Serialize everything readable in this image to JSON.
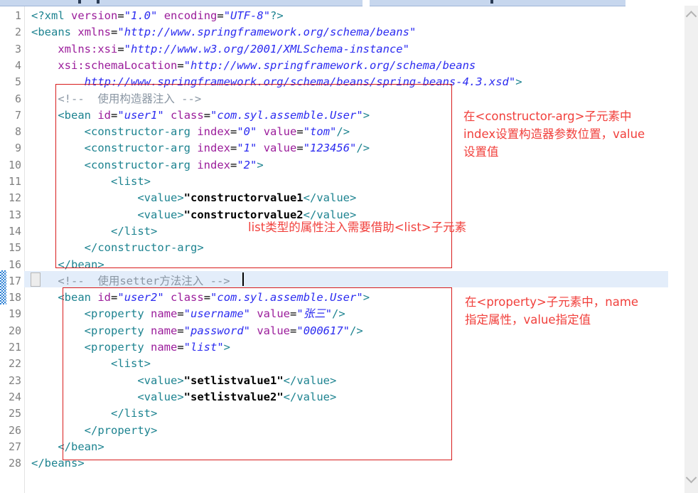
{
  "window": {
    "chrome_strips": [
      {
        "name": "toolbar-strip-left"
      },
      {
        "name": "toolbar-strip-right"
      }
    ]
  },
  "editor": {
    "language": "xml",
    "current_line": 17,
    "total_lines": 28,
    "colors": {
      "tag": "#1d8390",
      "attribute": "#9b1d9b",
      "value": "#2c2cf0",
      "comment": "#8a96a3",
      "text": "#000000",
      "annotation_red": "#f1403c",
      "box_red": "#d81c1c",
      "current_line_bg": "#e3edfa"
    },
    "line_numbers": [
      "1",
      "2",
      "3",
      "4",
      "5",
      "6",
      "7",
      "8",
      "9",
      "10",
      "11",
      "12",
      "13",
      "14",
      "15",
      "16",
      "17",
      "18",
      "19",
      "20",
      "21",
      "22",
      "23",
      "24",
      "25",
      "26",
      "27",
      "28"
    ],
    "lines": [
      {
        "n": 1,
        "text": "<?xml version=\"1.0\" encoding=\"UTF-8\"?>"
      },
      {
        "n": 2,
        "text": "<beans xmlns=\"http://www.springframework.org/schema/beans\""
      },
      {
        "n": 3,
        "text": "    xmlns:xsi=\"http://www.w3.org/2001/XMLSchema-instance\""
      },
      {
        "n": 4,
        "text": "    xsi:schemaLocation=\"http://www.springframework.org/schema/beans"
      },
      {
        "n": 5,
        "text": "        http://www.springframework.org/schema/beans/spring-beans-4.3.xsd\">"
      },
      {
        "n": 6,
        "text": "    <!--  使用构造器注入 -->"
      },
      {
        "n": 7,
        "text": "    <bean id=\"user1\" class=\"com.syl.assemble.User\">"
      },
      {
        "n": 8,
        "text": "        <constructor-arg index=\"0\" value=\"tom\"/>"
      },
      {
        "n": 9,
        "text": "        <constructor-arg index=\"1\" value=\"123456\"/>"
      },
      {
        "n": 10,
        "text": "        <constructor-arg index=\"2\">"
      },
      {
        "n": 11,
        "text": "            <list>"
      },
      {
        "n": 12,
        "text": "                <value>\"constructorvalue1</value>"
      },
      {
        "n": 13,
        "text": "                <value>\"constructorvalue2</value>"
      },
      {
        "n": 14,
        "text": "            </list>"
      },
      {
        "n": 15,
        "text": "        </constructor-arg>"
      },
      {
        "n": 16,
        "text": "    </bean>"
      },
      {
        "n": 17,
        "text": "    <!--  使用setter方法注入 -->"
      },
      {
        "n": 18,
        "text": "    <bean id=\"user2\" class=\"com.syl.assemble.User\">"
      },
      {
        "n": 19,
        "text": "        <property name=\"username\" value=\"张三\"/>"
      },
      {
        "n": 20,
        "text": "        <property name=\"password\" value=\"000617\"/>"
      },
      {
        "n": 21,
        "text": "        <property name=\"list\">"
      },
      {
        "n": 22,
        "text": "            <list>"
      },
      {
        "n": 23,
        "text": "                <value>\"setlistvalue1\"</value>"
      },
      {
        "n": 24,
        "text": "                <value>\"setlistvalue2\"</value>"
      },
      {
        "n": 25,
        "text": "            </list>"
      },
      {
        "n": 26,
        "text": "        </property>"
      },
      {
        "n": 27,
        "text": "    </bean>"
      },
      {
        "n": 28,
        "text": "</beans>"
      }
    ],
    "tokens": {
      "l1": [
        [
          "punct",
          "<?"
        ],
        [
          "tag",
          "xml"
        ],
        [
          "sp",
          " "
        ],
        [
          "attr",
          "version"
        ],
        [
          "eq",
          "="
        ],
        [
          "val",
          "\"1.0\""
        ],
        [
          "sp",
          " "
        ],
        [
          "attr",
          "encoding"
        ],
        [
          "eq",
          "="
        ],
        [
          "val",
          "\"UTF-8\""
        ],
        [
          "punct",
          "?>"
        ]
      ],
      "l2": [
        [
          "punct",
          "<"
        ],
        [
          "tag",
          "beans"
        ],
        [
          "sp",
          " "
        ],
        [
          "attr",
          "xmlns"
        ],
        [
          "eq",
          "="
        ],
        [
          "val",
          "\"http://www.springframework.org/schema/beans\""
        ]
      ],
      "l3": [
        [
          "ind",
          "    "
        ],
        [
          "attr",
          "xmlns:xsi"
        ],
        [
          "eq",
          "="
        ],
        [
          "val",
          "\"http://www.w3.org/2001/XMLSchema-instance\""
        ]
      ],
      "l4": [
        [
          "ind",
          "    "
        ],
        [
          "attr",
          "xsi:schemaLocation"
        ],
        [
          "eq",
          "="
        ],
        [
          "val",
          "\"http://www.springframework.org/schema/beans"
        ]
      ],
      "l5": [
        [
          "ind",
          "        "
        ],
        [
          "val",
          "http://www.springframework.org/schema/beans/spring-beans-4.3.xsd\""
        ],
        [
          "punct",
          ">"
        ]
      ],
      "l6": [
        [
          "ind",
          "    "
        ],
        [
          "comment",
          "<!--  使用构造器注入 -->"
        ]
      ],
      "l7": [
        [
          "ind",
          "    "
        ],
        [
          "punct",
          "<"
        ],
        [
          "tag",
          "bean"
        ],
        [
          "sp",
          " "
        ],
        [
          "attr",
          "id"
        ],
        [
          "eq",
          "="
        ],
        [
          "val",
          "\"user1\""
        ],
        [
          "sp",
          " "
        ],
        [
          "attr",
          "class"
        ],
        [
          "eq",
          "="
        ],
        [
          "val",
          "\"com.syl.assemble.User\""
        ],
        [
          "punct",
          ">"
        ]
      ],
      "l8": [
        [
          "ind",
          "        "
        ],
        [
          "punct",
          "<"
        ],
        [
          "tag",
          "constructor-arg"
        ],
        [
          "sp",
          " "
        ],
        [
          "attr",
          "index"
        ],
        [
          "eq",
          "="
        ],
        [
          "val",
          "\"0\""
        ],
        [
          "sp",
          " "
        ],
        [
          "attr",
          "value"
        ],
        [
          "eq",
          "="
        ],
        [
          "val",
          "\"tom\""
        ],
        [
          "punct",
          "/>"
        ]
      ],
      "l9": [
        [
          "ind",
          "        "
        ],
        [
          "punct",
          "<"
        ],
        [
          "tag",
          "constructor-arg"
        ],
        [
          "sp",
          " "
        ],
        [
          "attr",
          "index"
        ],
        [
          "eq",
          "="
        ],
        [
          "val",
          "\"1\""
        ],
        [
          "sp",
          " "
        ],
        [
          "attr",
          "value"
        ],
        [
          "eq",
          "="
        ],
        [
          "val",
          "\"123456\""
        ],
        [
          "punct",
          "/>"
        ]
      ],
      "l10": [
        [
          "ind",
          "        "
        ],
        [
          "punct",
          "<"
        ],
        [
          "tag",
          "constructor-arg"
        ],
        [
          "sp",
          " "
        ],
        [
          "attr",
          "index"
        ],
        [
          "eq",
          "="
        ],
        [
          "val",
          "\"2\""
        ],
        [
          "punct",
          ">"
        ]
      ],
      "l11": [
        [
          "ind",
          "            "
        ],
        [
          "punct",
          "<"
        ],
        [
          "tag",
          "list"
        ],
        [
          "punct",
          ">"
        ]
      ],
      "l12": [
        [
          "ind",
          "                "
        ],
        [
          "punct",
          "<"
        ],
        [
          "tag",
          "value"
        ],
        [
          "punct",
          ">"
        ],
        [
          "txt",
          "\"constructorvalue1"
        ],
        [
          "punct",
          "</"
        ],
        [
          "tag",
          "value"
        ],
        [
          "punct",
          ">"
        ]
      ],
      "l13": [
        [
          "ind",
          "                "
        ],
        [
          "punct",
          "<"
        ],
        [
          "tag",
          "value"
        ],
        [
          "punct",
          ">"
        ],
        [
          "txt",
          "\"constructorvalue2"
        ],
        [
          "punct",
          "</"
        ],
        [
          "tag",
          "value"
        ],
        [
          "punct",
          ">"
        ]
      ],
      "l14": [
        [
          "ind",
          "            "
        ],
        [
          "punct",
          "</"
        ],
        [
          "tag",
          "list"
        ],
        [
          "punct",
          ">"
        ]
      ],
      "l15": [
        [
          "ind",
          "        "
        ],
        [
          "punct",
          "</"
        ],
        [
          "tag",
          "constructor-arg"
        ],
        [
          "punct",
          ">"
        ]
      ],
      "l16": [
        [
          "ind",
          "    "
        ],
        [
          "punct",
          "</"
        ],
        [
          "tag",
          "bean"
        ],
        [
          "punct",
          ">"
        ]
      ],
      "l17": [
        [
          "ind",
          "    "
        ],
        [
          "comment",
          "<!--  使用setter方法注入 -->"
        ]
      ],
      "l18": [
        [
          "ind",
          "    "
        ],
        [
          "punct",
          "<"
        ],
        [
          "tag",
          "bean"
        ],
        [
          "sp",
          " "
        ],
        [
          "attr",
          "id"
        ],
        [
          "eq",
          "="
        ],
        [
          "val",
          "\"user2\""
        ],
        [
          "sp",
          " "
        ],
        [
          "attr",
          "class"
        ],
        [
          "eq",
          "="
        ],
        [
          "val",
          "\"com.syl.assemble.User\""
        ],
        [
          "punct",
          ">"
        ]
      ],
      "l19": [
        [
          "ind",
          "        "
        ],
        [
          "punct",
          "<"
        ],
        [
          "tag",
          "property"
        ],
        [
          "sp",
          " "
        ],
        [
          "attr",
          "name"
        ],
        [
          "eq",
          "="
        ],
        [
          "val",
          "\"username\""
        ],
        [
          "sp",
          " "
        ],
        [
          "attr",
          "value"
        ],
        [
          "eq",
          "="
        ],
        [
          "val",
          "\"张三\""
        ],
        [
          "punct",
          "/>"
        ]
      ],
      "l20": [
        [
          "ind",
          "        "
        ],
        [
          "punct",
          "<"
        ],
        [
          "tag",
          "property"
        ],
        [
          "sp",
          " "
        ],
        [
          "attr",
          "name"
        ],
        [
          "eq",
          "="
        ],
        [
          "val",
          "\"password\""
        ],
        [
          "sp",
          " "
        ],
        [
          "attr",
          "value"
        ],
        [
          "eq",
          "="
        ],
        [
          "val",
          "\"000617\""
        ],
        [
          "punct",
          "/>"
        ]
      ],
      "l21": [
        [
          "ind",
          "        "
        ],
        [
          "punct",
          "<"
        ],
        [
          "tag",
          "property"
        ],
        [
          "sp",
          " "
        ],
        [
          "attr",
          "name"
        ],
        [
          "eq",
          "="
        ],
        [
          "val",
          "\"list\""
        ],
        [
          "punct",
          ">"
        ]
      ],
      "l22": [
        [
          "ind",
          "            "
        ],
        [
          "punct",
          "<"
        ],
        [
          "tag",
          "list"
        ],
        [
          "punct",
          ">"
        ]
      ],
      "l23": [
        [
          "ind",
          "                "
        ],
        [
          "punct",
          "<"
        ],
        [
          "tag",
          "value"
        ],
        [
          "punct",
          ">"
        ],
        [
          "txt",
          "\"setlistvalue1\""
        ],
        [
          "punct",
          "</"
        ],
        [
          "tag",
          "value"
        ],
        [
          "punct",
          ">"
        ]
      ],
      "l24": [
        [
          "ind",
          "                "
        ],
        [
          "punct",
          "<"
        ],
        [
          "tag",
          "value"
        ],
        [
          "punct",
          ">"
        ],
        [
          "txt",
          "\"setlistvalue2\""
        ],
        [
          "punct",
          "</"
        ],
        [
          "tag",
          "value"
        ],
        [
          "punct",
          ">"
        ]
      ],
      "l25": [
        [
          "ind",
          "            "
        ],
        [
          "punct",
          "</"
        ],
        [
          "tag",
          "list"
        ],
        [
          "punct",
          ">"
        ]
      ],
      "l26": [
        [
          "ind",
          "        "
        ],
        [
          "punct",
          "</"
        ],
        [
          "tag",
          "property"
        ],
        [
          "punct",
          ">"
        ]
      ],
      "l27": [
        [
          "ind",
          "    "
        ],
        [
          "punct",
          "</"
        ],
        [
          "tag",
          "bean"
        ],
        [
          "punct",
          ">"
        ]
      ],
      "l28": [
        [
          "punct",
          "</"
        ],
        [
          "tag",
          "beans"
        ],
        [
          "punct",
          ">"
        ]
      ]
    }
  },
  "annotations": {
    "constructor_note": "在<constructor-arg>子元素中\nindex设置构造器参数位置，value\n设置值",
    "setter_note": "在<property>子元素中，name\n指定属性，value指定值",
    "list_inline_note": "list类型的属性注入需要借助<list>子元素"
  },
  "scrollbar": {
    "up_arrow": "chevron-up-icon",
    "down_arrow": "chevron-down-icon"
  }
}
